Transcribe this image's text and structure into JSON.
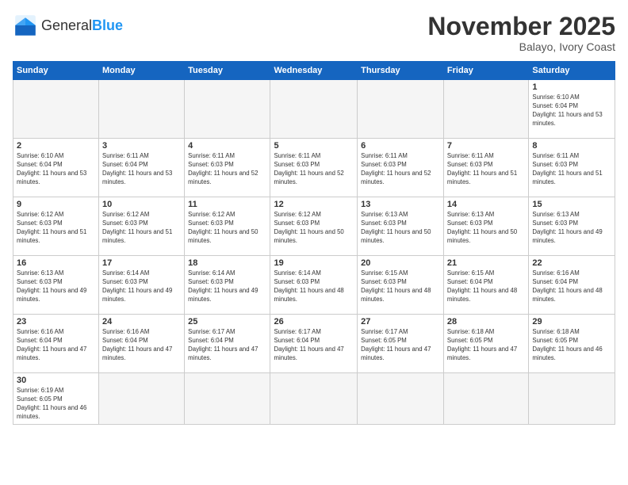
{
  "header": {
    "logo_general": "General",
    "logo_blue": "Blue",
    "month_title": "November 2025",
    "location": "Balayo, Ivory Coast"
  },
  "weekdays": [
    "Sunday",
    "Monday",
    "Tuesday",
    "Wednesday",
    "Thursday",
    "Friday",
    "Saturday"
  ],
  "weeks": [
    [
      {
        "day": "",
        "empty": true
      },
      {
        "day": "",
        "empty": true
      },
      {
        "day": "",
        "empty": true
      },
      {
        "day": "",
        "empty": true
      },
      {
        "day": "",
        "empty": true
      },
      {
        "day": "",
        "empty": true
      },
      {
        "day": "1",
        "sunrise": "Sunrise: 6:10 AM",
        "sunset": "Sunset: 6:04 PM",
        "daylight": "Daylight: 11 hours and 53 minutes."
      }
    ],
    [
      {
        "day": "2",
        "sunrise": "Sunrise: 6:10 AM",
        "sunset": "Sunset: 6:04 PM",
        "daylight": "Daylight: 11 hours and 53 minutes."
      },
      {
        "day": "3",
        "sunrise": "Sunrise: 6:11 AM",
        "sunset": "Sunset: 6:04 PM",
        "daylight": "Daylight: 11 hours and 53 minutes."
      },
      {
        "day": "4",
        "sunrise": "Sunrise: 6:11 AM",
        "sunset": "Sunset: 6:03 PM",
        "daylight": "Daylight: 11 hours and 52 minutes."
      },
      {
        "day": "5",
        "sunrise": "Sunrise: 6:11 AM",
        "sunset": "Sunset: 6:03 PM",
        "daylight": "Daylight: 11 hours and 52 minutes."
      },
      {
        "day": "6",
        "sunrise": "Sunrise: 6:11 AM",
        "sunset": "Sunset: 6:03 PM",
        "daylight": "Daylight: 11 hours and 52 minutes."
      },
      {
        "day": "7",
        "sunrise": "Sunrise: 6:11 AM",
        "sunset": "Sunset: 6:03 PM",
        "daylight": "Daylight: 11 hours and 51 minutes."
      },
      {
        "day": "8",
        "sunrise": "Sunrise: 6:11 AM",
        "sunset": "Sunset: 6:03 PM",
        "daylight": "Daylight: 11 hours and 51 minutes."
      }
    ],
    [
      {
        "day": "9",
        "sunrise": "Sunrise: 6:12 AM",
        "sunset": "Sunset: 6:03 PM",
        "daylight": "Daylight: 11 hours and 51 minutes."
      },
      {
        "day": "10",
        "sunrise": "Sunrise: 6:12 AM",
        "sunset": "Sunset: 6:03 PM",
        "daylight": "Daylight: 11 hours and 51 minutes."
      },
      {
        "day": "11",
        "sunrise": "Sunrise: 6:12 AM",
        "sunset": "Sunset: 6:03 PM",
        "daylight": "Daylight: 11 hours and 50 minutes."
      },
      {
        "day": "12",
        "sunrise": "Sunrise: 6:12 AM",
        "sunset": "Sunset: 6:03 PM",
        "daylight": "Daylight: 11 hours and 50 minutes."
      },
      {
        "day": "13",
        "sunrise": "Sunrise: 6:13 AM",
        "sunset": "Sunset: 6:03 PM",
        "daylight": "Daylight: 11 hours and 50 minutes."
      },
      {
        "day": "14",
        "sunrise": "Sunrise: 6:13 AM",
        "sunset": "Sunset: 6:03 PM",
        "daylight": "Daylight: 11 hours and 50 minutes."
      },
      {
        "day": "15",
        "sunrise": "Sunrise: 6:13 AM",
        "sunset": "Sunset: 6:03 PM",
        "daylight": "Daylight: 11 hours and 49 minutes."
      }
    ],
    [
      {
        "day": "16",
        "sunrise": "Sunrise: 6:13 AM",
        "sunset": "Sunset: 6:03 PM",
        "daylight": "Daylight: 11 hours and 49 minutes."
      },
      {
        "day": "17",
        "sunrise": "Sunrise: 6:14 AM",
        "sunset": "Sunset: 6:03 PM",
        "daylight": "Daylight: 11 hours and 49 minutes."
      },
      {
        "day": "18",
        "sunrise": "Sunrise: 6:14 AM",
        "sunset": "Sunset: 6:03 PM",
        "daylight": "Daylight: 11 hours and 49 minutes."
      },
      {
        "day": "19",
        "sunrise": "Sunrise: 6:14 AM",
        "sunset": "Sunset: 6:03 PM",
        "daylight": "Daylight: 11 hours and 48 minutes."
      },
      {
        "day": "20",
        "sunrise": "Sunrise: 6:15 AM",
        "sunset": "Sunset: 6:03 PM",
        "daylight": "Daylight: 11 hours and 48 minutes."
      },
      {
        "day": "21",
        "sunrise": "Sunrise: 6:15 AM",
        "sunset": "Sunset: 6:04 PM",
        "daylight": "Daylight: 11 hours and 48 minutes."
      },
      {
        "day": "22",
        "sunrise": "Sunrise: 6:16 AM",
        "sunset": "Sunset: 6:04 PM",
        "daylight": "Daylight: 11 hours and 48 minutes."
      }
    ],
    [
      {
        "day": "23",
        "sunrise": "Sunrise: 6:16 AM",
        "sunset": "Sunset: 6:04 PM",
        "daylight": "Daylight: 11 hours and 47 minutes."
      },
      {
        "day": "24",
        "sunrise": "Sunrise: 6:16 AM",
        "sunset": "Sunset: 6:04 PM",
        "daylight": "Daylight: 11 hours and 47 minutes."
      },
      {
        "day": "25",
        "sunrise": "Sunrise: 6:17 AM",
        "sunset": "Sunset: 6:04 PM",
        "daylight": "Daylight: 11 hours and 47 minutes."
      },
      {
        "day": "26",
        "sunrise": "Sunrise: 6:17 AM",
        "sunset": "Sunset: 6:04 PM",
        "daylight": "Daylight: 11 hours and 47 minutes."
      },
      {
        "day": "27",
        "sunrise": "Sunrise: 6:17 AM",
        "sunset": "Sunset: 6:05 PM",
        "daylight": "Daylight: 11 hours and 47 minutes."
      },
      {
        "day": "28",
        "sunrise": "Sunrise: 6:18 AM",
        "sunset": "Sunset: 6:05 PM",
        "daylight": "Daylight: 11 hours and 47 minutes."
      },
      {
        "day": "29",
        "sunrise": "Sunrise: 6:18 AM",
        "sunset": "Sunset: 6:05 PM",
        "daylight": "Daylight: 11 hours and 46 minutes."
      }
    ],
    [
      {
        "day": "30",
        "sunrise": "Sunrise: 6:19 AM",
        "sunset": "Sunset: 6:05 PM",
        "daylight": "Daylight: 11 hours and 46 minutes."
      },
      {
        "day": "",
        "empty": true
      },
      {
        "day": "",
        "empty": true
      },
      {
        "day": "",
        "empty": true
      },
      {
        "day": "",
        "empty": true
      },
      {
        "day": "",
        "empty": true
      },
      {
        "day": "",
        "empty": true
      }
    ]
  ]
}
